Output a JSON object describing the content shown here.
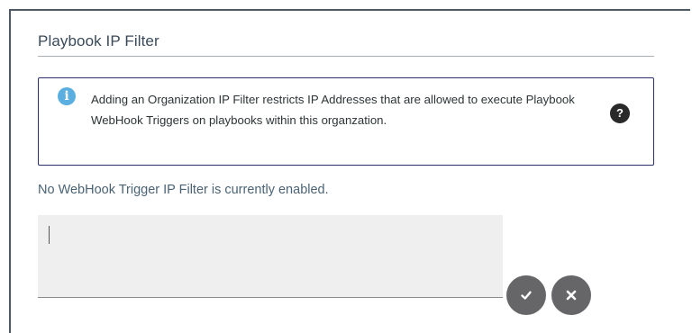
{
  "section": {
    "title": "Playbook IP Filter"
  },
  "info": {
    "icon": "info-icon",
    "message": "Adding an Organization IP Filter restricts IP Addresses that are allowed to execute Playbook WebHook Triggers on playbooks within this organzation.",
    "help_icon": "question-mark-icon",
    "help_glyph": "?"
  },
  "status": {
    "text": "No WebHook Trigger IP Filter is currently enabled."
  },
  "ip_filter_input": {
    "value": "",
    "placeholder": ""
  },
  "actions": {
    "confirm_icon": "checkmark-icon",
    "cancel_icon": "close-icon"
  },
  "colors": {
    "info_border": "#2b2f6b",
    "info_icon": "#5aaee0",
    "action_button": "#666669",
    "status_text": "#4a6375"
  }
}
